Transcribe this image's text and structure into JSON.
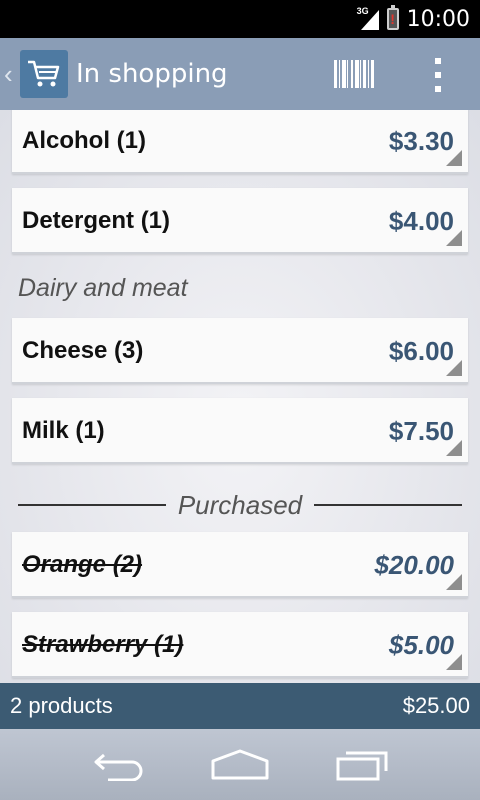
{
  "status_bar": {
    "network": "3G",
    "time": "10:00"
  },
  "action_bar": {
    "title": "In shopping"
  },
  "items_top": [
    {
      "name": "Alcohol (1)",
      "price": "$3.30"
    },
    {
      "name": "Detergent (1)",
      "price": "$4.00"
    }
  ],
  "sections": [
    {
      "title": "Dairy and meat",
      "items": [
        {
          "name": "Cheese (3)",
          "price": "$6.00"
        },
        {
          "name": "Milk (1)",
          "price": "$7.50"
        }
      ]
    }
  ],
  "purchased": {
    "label": "Purchased",
    "items": [
      {
        "name": "Orange (2)",
        "price": "$20.00"
      },
      {
        "name": "Strawberry (1)",
        "price": "$5.00"
      }
    ]
  },
  "summary": {
    "count": "2 products",
    "total": "$25.00"
  },
  "colors": {
    "action_bar": "#8a9db6",
    "summary_bar": "#3c5b73",
    "price": "#3a5674"
  },
  "icons": [
    "shopping-cart-icon",
    "barcode-icon",
    "overflow-menu-icon",
    "back-icon",
    "home-icon",
    "recents-icon"
  ]
}
